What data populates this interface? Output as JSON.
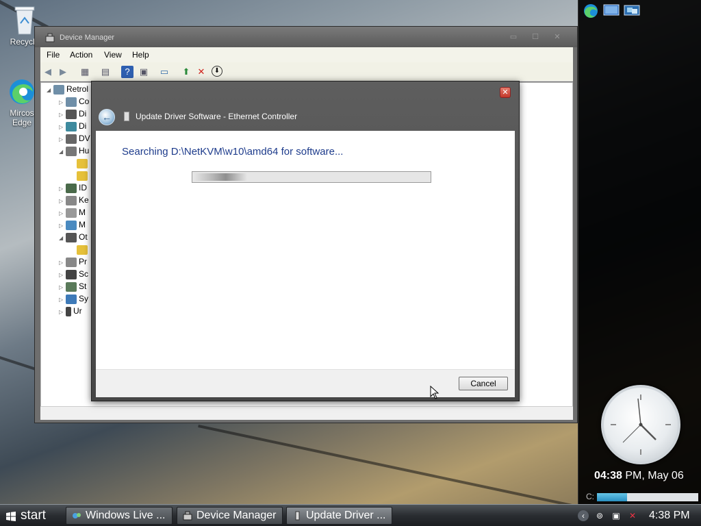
{
  "desktop": {
    "icons": [
      {
        "label": "Recycle"
      },
      {
        "label": "Mircos\nEdge"
      }
    ]
  },
  "device_manager": {
    "title": "Device Manager",
    "menu": [
      "File",
      "Action",
      "View",
      "Help"
    ],
    "tree": [
      {
        "label": "Retrol",
        "expanded": true,
        "level": 0
      },
      {
        "label": "Co",
        "level": 1
      },
      {
        "label": "Di",
        "level": 1
      },
      {
        "label": "Di",
        "level": 1
      },
      {
        "label": "DV",
        "level": 1
      },
      {
        "label": "Hu",
        "expanded": true,
        "level": 1
      },
      {
        "label": "",
        "level": 2
      },
      {
        "label": "",
        "level": 2
      },
      {
        "label": "ID",
        "level": 1
      },
      {
        "label": "Ke",
        "level": 1
      },
      {
        "label": "M",
        "level": 1
      },
      {
        "label": "M",
        "level": 1
      },
      {
        "label": "Ot",
        "expanded": true,
        "level": 1
      },
      {
        "label": "",
        "level": 2
      },
      {
        "label": "Pr",
        "level": 1
      },
      {
        "label": "Sc",
        "level": 1
      },
      {
        "label": "St",
        "level": 1
      },
      {
        "label": "Sy",
        "level": 1
      },
      {
        "label": "Ur",
        "level": 1
      }
    ]
  },
  "update_driver": {
    "title": "Update Driver Software - Ethernet Controller",
    "status": "Searching D:\\NetKVM\\w10\\amd64 for software...",
    "cancel_label": "Cancel"
  },
  "sidebar": {
    "clock_time_bold": "04:38",
    "clock_time_rest": " PM, May 06",
    "cpu_label": "C:",
    "cpu_level": 0.3
  },
  "taskbar": {
    "start_label": "start",
    "buttons": [
      {
        "label": "Windows Live ..."
      },
      {
        "label": "Device Manager"
      },
      {
        "label": "Update Driver ..."
      }
    ],
    "time": "4:38 PM"
  }
}
